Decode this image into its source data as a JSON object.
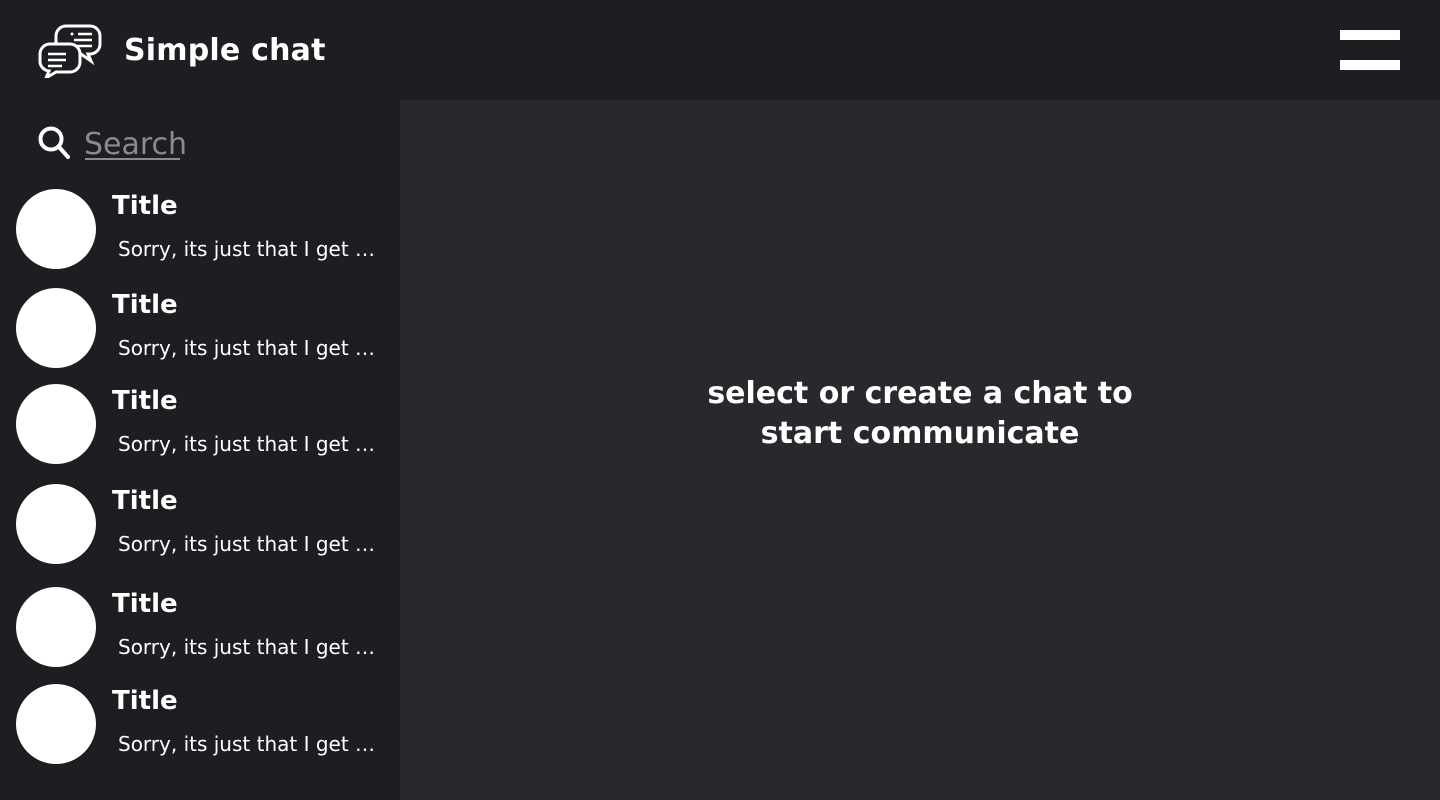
{
  "header": {
    "app_title": "Simple chat",
    "logo_icon": "chat-bubbles-icon",
    "menu_icon": "hamburger-menu-icon"
  },
  "sidebar": {
    "search": {
      "placeholder": "Search",
      "icon": "search-icon"
    },
    "chats": [
      {
        "title": "Title",
        "preview": "Sorry, its just that I get very nervous"
      },
      {
        "title": "Title",
        "preview": "Sorry, its just that I get very nervous"
      },
      {
        "title": "Title",
        "preview": "Sorry, its just that I get very nervous"
      },
      {
        "title": "Title",
        "preview": "Sorry, its just that I get very nervous"
      },
      {
        "title": "Title",
        "preview": "Sorry, its just that I get very nervous"
      },
      {
        "title": "Title",
        "preview": "Sorry, its just that I get very nervous"
      }
    ]
  },
  "main": {
    "empty_line_1": "select or create a chat to",
    "empty_line_2": "start communicate"
  },
  "colors": {
    "header_bg": "#1d1e21",
    "sidebar_bg": "#1d1e21",
    "main_bg": "#28292d",
    "text": "#ffffff",
    "muted": "#8a8b8f"
  }
}
